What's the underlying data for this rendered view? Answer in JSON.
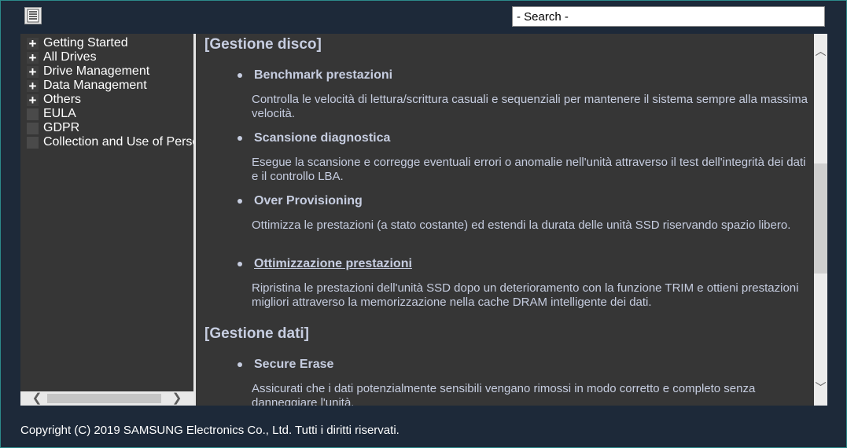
{
  "toolbar": {
    "toc_icon": "list-icon",
    "search_placeholder": "- Search -"
  },
  "tree": {
    "items": [
      {
        "label": "Getting Started",
        "expand": "+"
      },
      {
        "label": "All Drives",
        "expand": "+"
      },
      {
        "label": "Drive Management",
        "expand": "+"
      },
      {
        "label": "Data Management",
        "expand": "+"
      },
      {
        "label": "Others",
        "expand": "+"
      },
      {
        "label": "EULA",
        "expand": ""
      },
      {
        "label": "GDPR",
        "expand": ""
      },
      {
        "label": "Collection and Use of Personal Information",
        "expand": ""
      }
    ],
    "scroll_left": "❮",
    "scroll_right": "❯"
  },
  "content": {
    "sections": [
      {
        "heading": "[Gestione disco]",
        "items": [
          {
            "title": "Benchmark prestazioni",
            "desc": "Controlla le velocità di lettura/scrittura casuali e sequenziali per mantenere il sistema sempre alla massima velocità."
          },
          {
            "title": "Scansione diagnostica",
            "desc": "Esegue la scansione e corregge eventuali errori o anomalie nell'unità attraverso il test dell'integrità dei dati e il controllo LBA."
          },
          {
            "title": "Over Provisioning",
            "desc": "Ottimizza le prestazioni (a stato costante) ed estendi la durata delle unità SSD riservando spazio libero."
          },
          {
            "title": "Ottimizzazione prestazioni",
            "desc": "Ripristina le prestazioni dell'unità SSD dopo un deterioramento con la funzione TRIM e ottieni prestazioni migliori attraverso la memorizzazione nella cache DRAM intelligente dei dati."
          }
        ]
      },
      {
        "heading": "[Gestione dati]",
        "items": [
          {
            "title": "Secure Erase",
            "desc": "Assicurati che i dati potenzialmente sensibili vengano rimossi in modo corretto e completo senza danneggiare l'unità."
          }
        ]
      }
    ],
    "scroll_up": "︿",
    "scroll_down": "﹀"
  },
  "footer": {
    "copyright": "Copyright (C) 2019 SAMSUNG Electronics Co., Ltd. Tutti i diritti riservati."
  }
}
